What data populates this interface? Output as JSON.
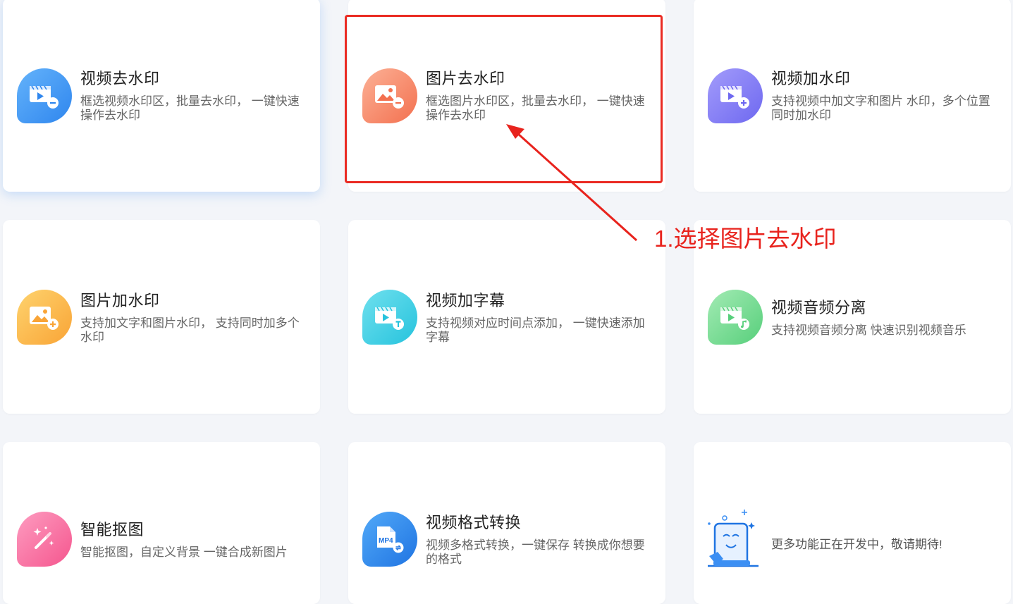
{
  "cards": [
    {
      "title": "视频去水印",
      "desc": "框选视频水印区，批量去水印， 一键快速操作去水印",
      "icon": "video-remove-watermark-icon",
      "gradient": [
        "#64b3fb",
        "#2f86ee"
      ]
    },
    {
      "title": "图片去水印",
      "desc": "框选图片水印区，批量去水印， 一键快速操作去水印",
      "icon": "image-remove-watermark-icon",
      "gradient": [
        "#fcb196",
        "#f3704f"
      ]
    },
    {
      "title": "视频加水印",
      "desc": "支持视频中加文字和图片 水印，多个位置同时加水印",
      "icon": "video-add-watermark-icon",
      "gradient": [
        "#a39cfb",
        "#6e68f0"
      ]
    },
    {
      "title": "图片加水印",
      "desc": "支持加文字和图片水印， 支持同时加多个水印",
      "icon": "image-add-watermark-icon",
      "gradient": [
        "#fed36e",
        "#f9a436"
      ]
    },
    {
      "title": "视频加字幕",
      "desc": "支持视频对应时间点添加， 一键快速添加字幕",
      "icon": "video-subtitle-icon",
      "gradient": [
        "#6fe0ee",
        "#26c3dd"
      ]
    },
    {
      "title": "视频音频分离",
      "desc": "支持视频音频分离 快速识别视频音乐",
      "icon": "audio-video-split-icon",
      "gradient": [
        "#a3ebb4",
        "#57cf7b"
      ]
    },
    {
      "title": "智能抠图",
      "desc": "智能抠图，自定义背景 一键合成新图片",
      "icon": "magic-wand-icon",
      "gradient": [
        "#fd9cc0",
        "#f5568e"
      ]
    },
    {
      "title": "视频格式转换",
      "desc": "视频多格式转换，一键保存 转换成你想要的格式",
      "icon": "mp4-convert-icon",
      "badge": "MP4",
      "gradient": [
        "#52a9f8",
        "#1f74e2"
      ]
    },
    {
      "title": "",
      "desc": "更多功能正在开发中，敬请期待!",
      "icon": "developer-phone-illustration-icon"
    }
  ],
  "annotation": {
    "callout_text": "1.选择图片去水印",
    "color": "#e8231d"
  }
}
